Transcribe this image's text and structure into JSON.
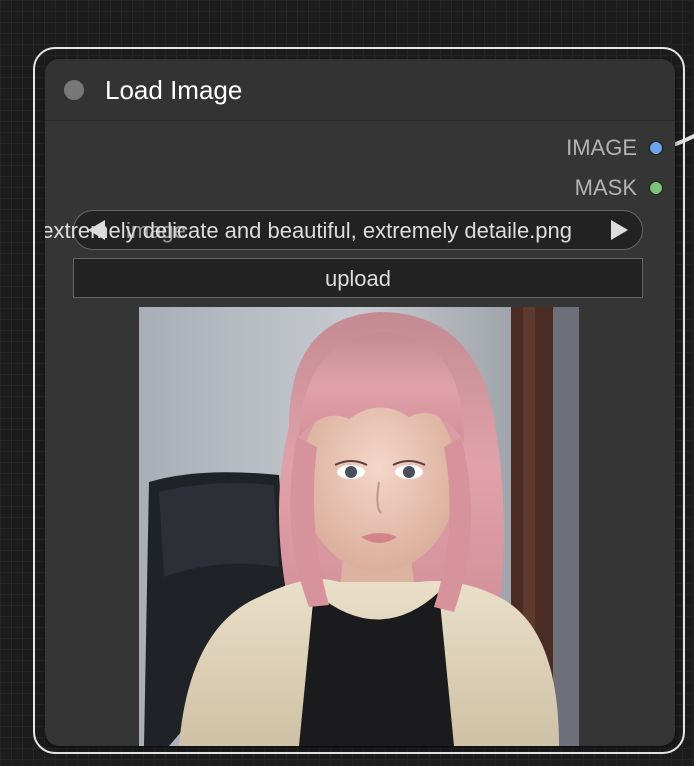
{
  "node": {
    "title": "Load Image",
    "outputs": [
      {
        "label": "IMAGE",
        "color": "#6aa6ee"
      },
      {
        "label": "MASK",
        "color": "#7cc47a"
      }
    ],
    "image_widget": {
      "name": "image",
      "value": "extremely delicate and beautiful, extremely detaile.png"
    },
    "upload_label": "upload"
  },
  "colors": {
    "link_wire": "#e0e0e0",
    "selection_outline": "#e6e6e6",
    "node_body": "#353535"
  }
}
